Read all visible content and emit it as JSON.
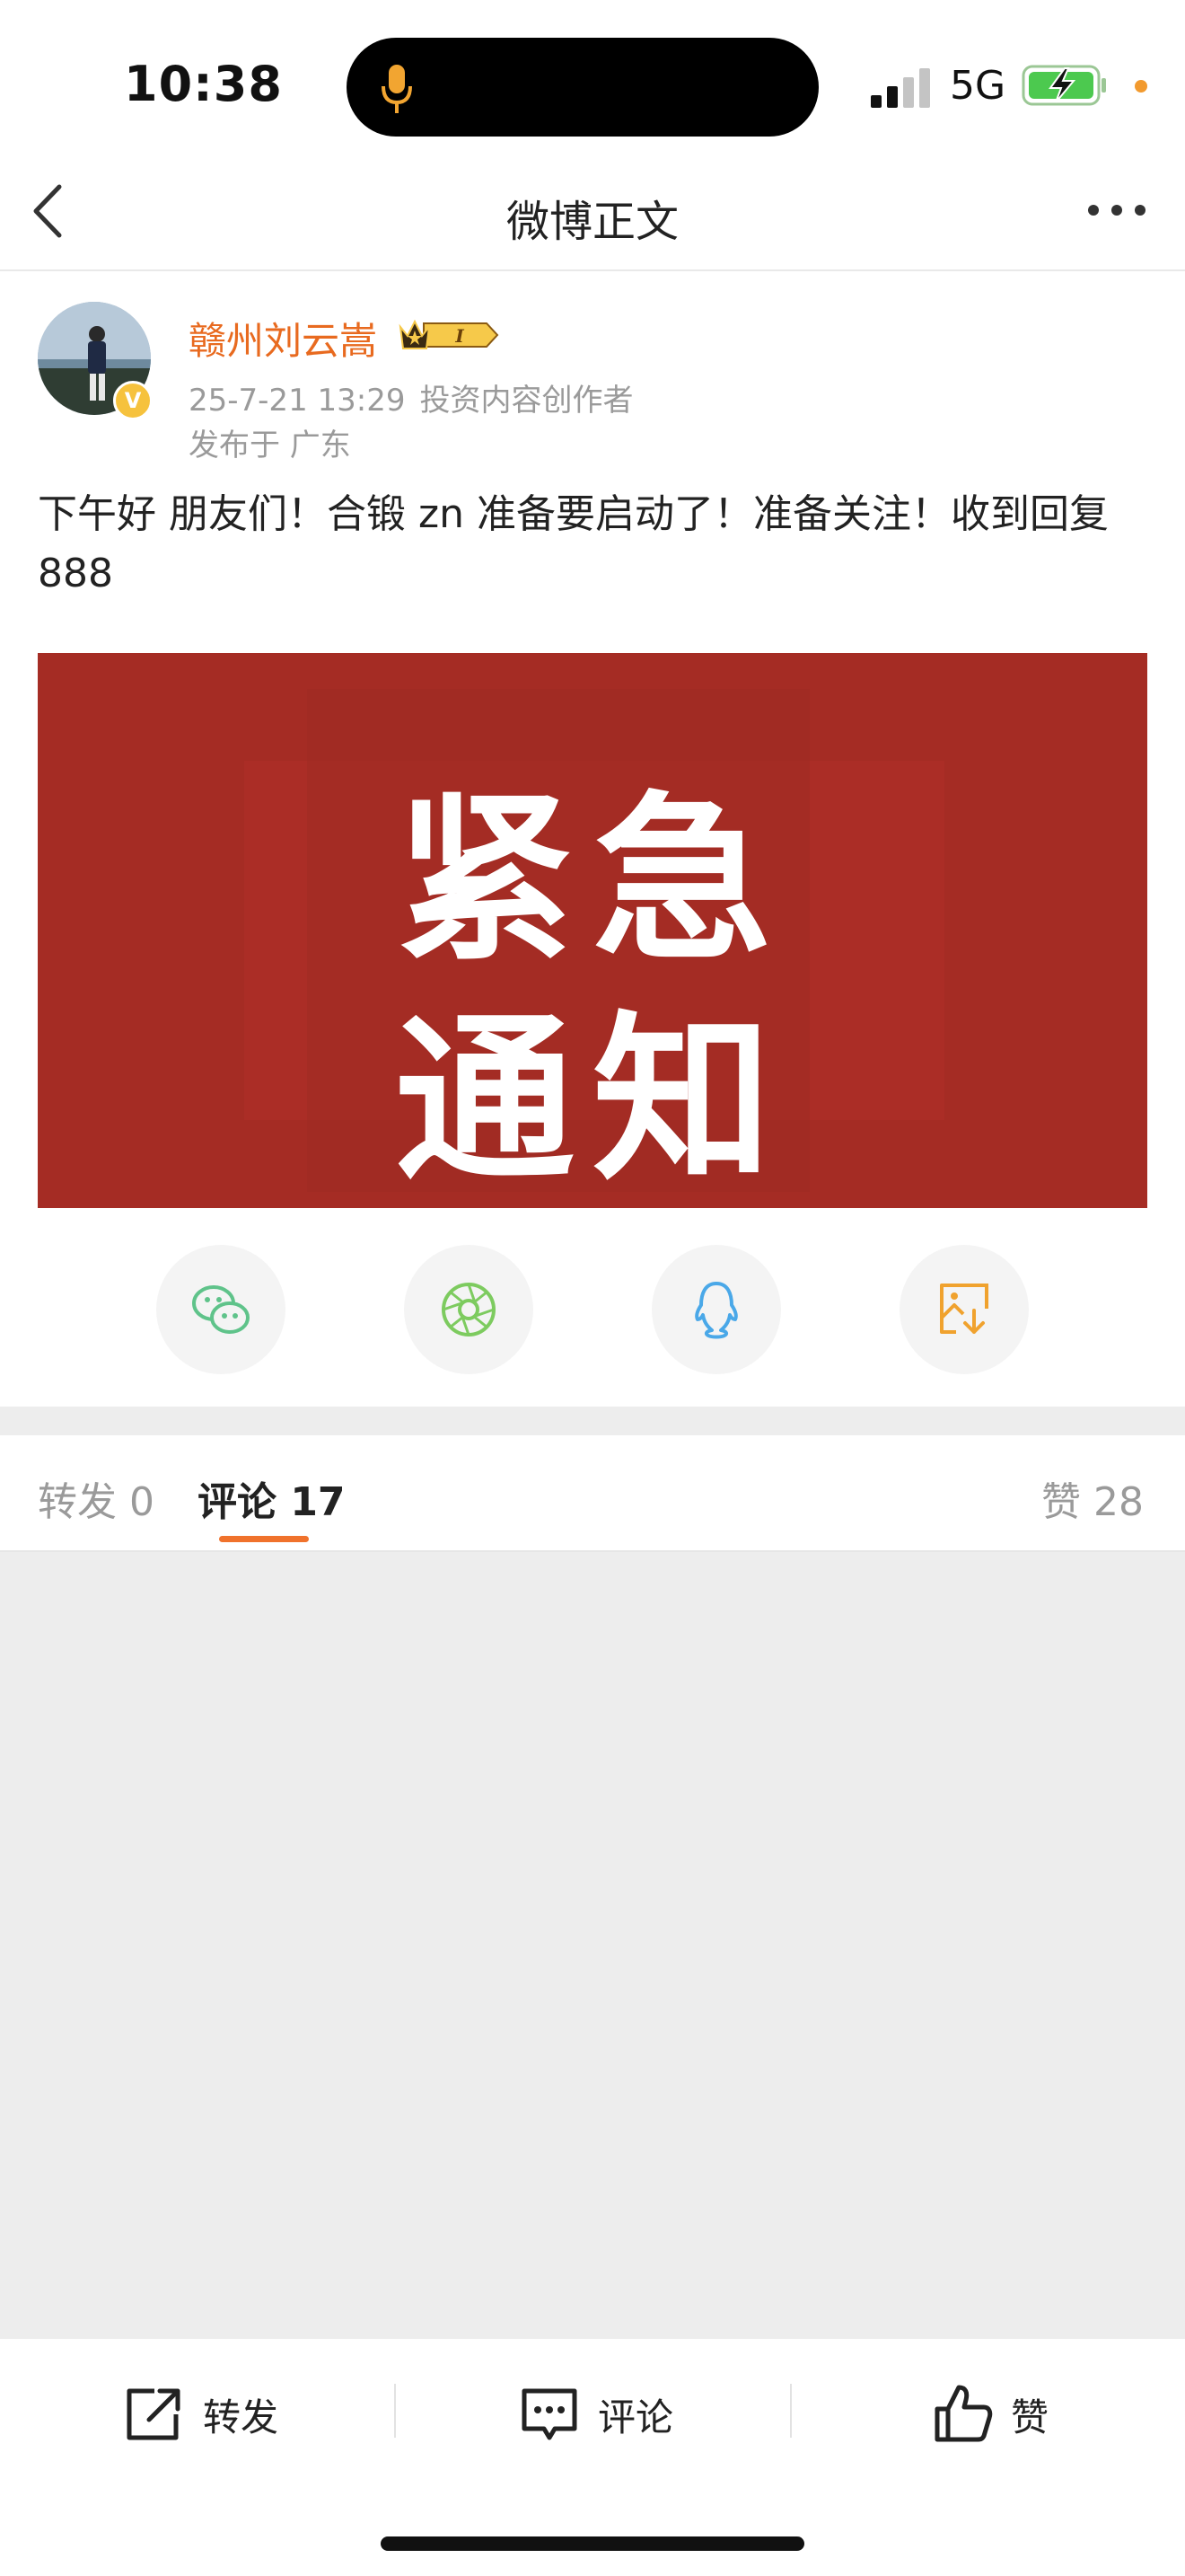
{
  "status_bar": {
    "time": "10:38",
    "network": "5G"
  },
  "nav": {
    "title": "微博正文"
  },
  "post": {
    "username": "赣州刘云嵩",
    "date": "25-7-21 13:29",
    "tag": "投资内容创作者",
    "location": "发布于 广东",
    "content": "下午好  朋友们！合锻 zn 准备要启动了！准备关注！收到回复 888",
    "image_text_line1": "紧急",
    "image_text_line2": "通知",
    "badge_letter": "V",
    "vip_letter": "I"
  },
  "share": [
    "wechat-icon",
    "moments-icon",
    "qq-icon",
    "save-image-icon"
  ],
  "tabs": {
    "repost": "转发 0",
    "comment": "评论 17",
    "like": "赞 28"
  },
  "bottom_bar": {
    "repost": "转发",
    "comment": "评论",
    "like": "赞"
  },
  "colors": {
    "accent": "#f0722c",
    "username": "#e86a1f",
    "banner": "#a52c24"
  }
}
